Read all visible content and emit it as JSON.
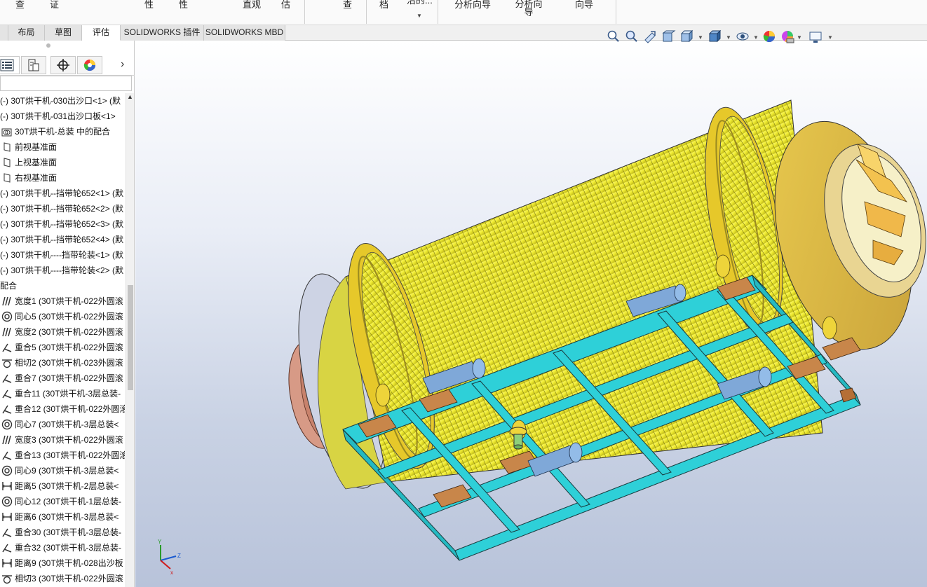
{
  "ribbon": {
    "labels": [
      "查",
      "证",
      "性",
      "性",
      "直观",
      "估",
      "查",
      "档",
      "沿的...",
      "分析向导",
      "分析向导",
      "向导"
    ],
    "label_items": [
      {
        "text": "查"
      },
      {
        "text": "证"
      },
      {
        "text": "性"
      },
      {
        "text": "性"
      },
      {
        "text": "直观"
      },
      {
        "text": "估"
      },
      {
        "text": "查"
      },
      {
        "text": "档"
      },
      {
        "text": "沿的..."
      },
      {
        "text": "分析向导"
      },
      {
        "text": "分析向导"
      },
      {
        "text": "向导"
      }
    ]
  },
  "tabs": [
    {
      "label": "布局",
      "active": false
    },
    {
      "label": "草图",
      "active": false
    },
    {
      "label": "评估",
      "active": true
    },
    {
      "label": "SOLIDWORKS 插件",
      "active": false
    },
    {
      "label": "SOLIDWORKS MBD",
      "active": false
    }
  ],
  "panel_tabs": [
    {
      "icon": "feature-manager-tree-icon",
      "active": true
    },
    {
      "icon": "property-manager-icon",
      "active": false
    },
    {
      "icon": "configuration-manager-icon",
      "active": false
    },
    {
      "icon": "display-manager-icon",
      "active": false
    }
  ],
  "tree": [
    {
      "icon": "none",
      "text": "(-) 30T烘干机-030出沙口<1> (默"
    },
    {
      "icon": "none",
      "text": "(-) 30T烘干机-031出沙口板<1>"
    },
    {
      "icon": "mates-folder-icon",
      "text": "30T烘干机-总装 中的配合"
    },
    {
      "icon": "plane-icon",
      "text": "前视基准面"
    },
    {
      "icon": "plane-icon",
      "text": "上视基准面"
    },
    {
      "icon": "plane-icon",
      "text": "右视基准面"
    },
    {
      "icon": "none",
      "text": "(-) 30T烘干机--挡带轮652<1> (默"
    },
    {
      "icon": "none",
      "text": "(-) 30T烘干机--挡带轮652<2> (默"
    },
    {
      "icon": "none",
      "text": "(-) 30T烘干机--挡带轮652<3> (默"
    },
    {
      "icon": "none",
      "text": "(-) 30T烘干机--挡带轮652<4> (默"
    },
    {
      "icon": "none",
      "text": "(-) 30T烘干机----挡带轮装<1> (默"
    },
    {
      "icon": "none",
      "text": "(-) 30T烘干机----挡带轮装<2> (默"
    },
    {
      "icon": "none",
      "text": "配合"
    },
    {
      "icon": "width-mate-icon",
      "text": "宽度1 (30T烘干机-022外圆滚"
    },
    {
      "icon": "concentric-mate-icon",
      "text": "同心5 (30T烘干机-022外圆滚"
    },
    {
      "icon": "width-mate-icon",
      "text": "宽度2 (30T烘干机-022外圆滚"
    },
    {
      "icon": "coincident-mate-icon",
      "text": "重合5 (30T烘干机-022外圆滚"
    },
    {
      "icon": "tangent-mate-icon",
      "text": "相切2 (30T烘干机-023外圆滚"
    },
    {
      "icon": "coincident-mate-icon",
      "text": "重合7 (30T烘干机-022外圆滚"
    },
    {
      "icon": "coincident-mate-icon",
      "text": "重合11 (30T烘干机-3层总装-"
    },
    {
      "icon": "coincident-mate-icon",
      "text": "重合12 (30T烘干机-022外圆滚"
    },
    {
      "icon": "concentric-mate-icon",
      "text": "同心7 (30T烘干机-3层总装<"
    },
    {
      "icon": "width-mate-icon",
      "text": "宽度3 (30T烘干机-022外圆滚"
    },
    {
      "icon": "coincident-mate-icon",
      "text": "重合13 (30T烘干机-022外圆滚"
    },
    {
      "icon": "concentric-mate-icon",
      "text": "同心9 (30T烘干机-3层总装<"
    },
    {
      "icon": "distance-mate-icon",
      "text": "距离5 (30T烘干机-2层总装<"
    },
    {
      "icon": "concentric-mate-icon",
      "text": "同心12 (30T烘干机-1层总装-"
    },
    {
      "icon": "distance-mate-icon",
      "text": "距离6 (30T烘干机-3层总装<"
    },
    {
      "icon": "coincident-mate-icon",
      "text": "重合30 (30T烘干机-3层总装-"
    },
    {
      "icon": "coincident-mate-icon",
      "text": "重合32 (30T烘干机-3层总装-"
    },
    {
      "icon": "distance-mate-icon",
      "text": "距离9 (30T烘干机-028出沙板"
    },
    {
      "icon": "tangent-mate-icon",
      "text": "相切3 (30T烘干机-022外圆滚"
    }
  ],
  "hud_icons": [
    "zoom-to-fit-icon",
    "zoom-to-area-icon",
    "previous-view-icon",
    "section-view-icon",
    "view-orientation-icon",
    "display-style-icon",
    "hide-show-items-icon",
    "edit-appearance-icon",
    "apply-scene-icon",
    "view-settings-icon"
  ],
  "triad": {
    "x": "x",
    "y": "Y",
    "z": "Z"
  },
  "colors": {
    "drum": "#f2ef3c",
    "ring": "#e8cf2c",
    "frame": "#2ed0d8",
    "endcap": "#d8b848",
    "inlet": "#d79a86",
    "pad": "#c8864a"
  }
}
